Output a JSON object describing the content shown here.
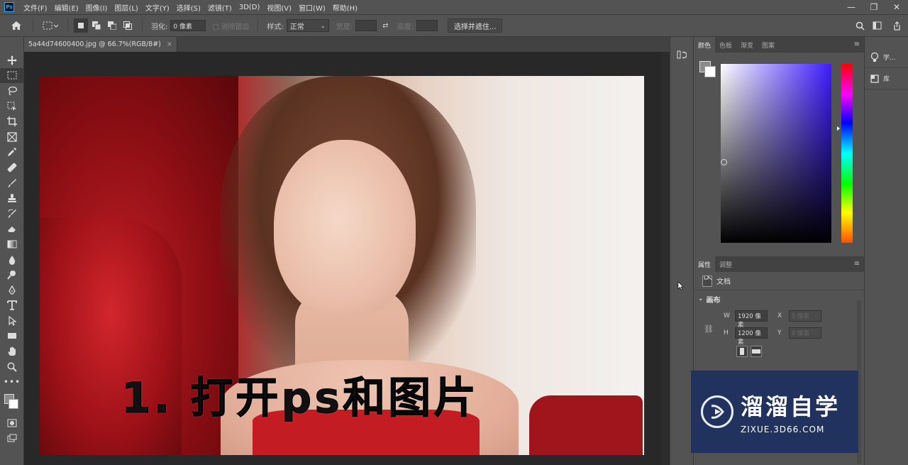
{
  "app": {
    "logo": "Ps"
  },
  "menu": [
    "文件(F)",
    "编辑(E)",
    "图像(I)",
    "图层(L)",
    "文字(Y)",
    "选择(S)",
    "滤镜(T)",
    "3D(D)",
    "视图(V)",
    "窗口(W)",
    "帮助(H)"
  ],
  "window_controls": {
    "minimize": "—",
    "restore": "❐",
    "close": "✕"
  },
  "options": {
    "feather_label": "羽化:",
    "feather_value": "0 像素",
    "antialias_label": "消除锯齿",
    "style_label": "样式:",
    "style_value": "正常",
    "width_label": "宽度:",
    "height_label": "高度:",
    "select_mask_button": "选择并遮住..."
  },
  "document": {
    "tab_title": "5a44d74600400.jpg @ 66.7%(RGB/8#)",
    "tab_close": "×",
    "caption": "1. 打开ps和图片"
  },
  "color_panel": {
    "tabs": [
      "颜色",
      "色板",
      "渐变",
      "图案"
    ],
    "active_tab": 0,
    "hue_color": "#3d1cff"
  },
  "properties_panel": {
    "tabs": [
      "属性",
      "调整"
    ],
    "active_tab": 0,
    "doc_label": "文档",
    "section_title": "画布",
    "w_label": "W",
    "w_value": "1920 像素",
    "h_label": "H",
    "h_value": "1200 像素",
    "x_label": "X",
    "x_placeholder": "0 像素",
    "y_label": "Y",
    "y_placeholder": "0 像素"
  },
  "right_strip": {
    "items": [
      "学...",
      "库"
    ]
  },
  "watermark": {
    "title": "溜溜自学",
    "url": "ZIXUE.3D66.COM"
  }
}
